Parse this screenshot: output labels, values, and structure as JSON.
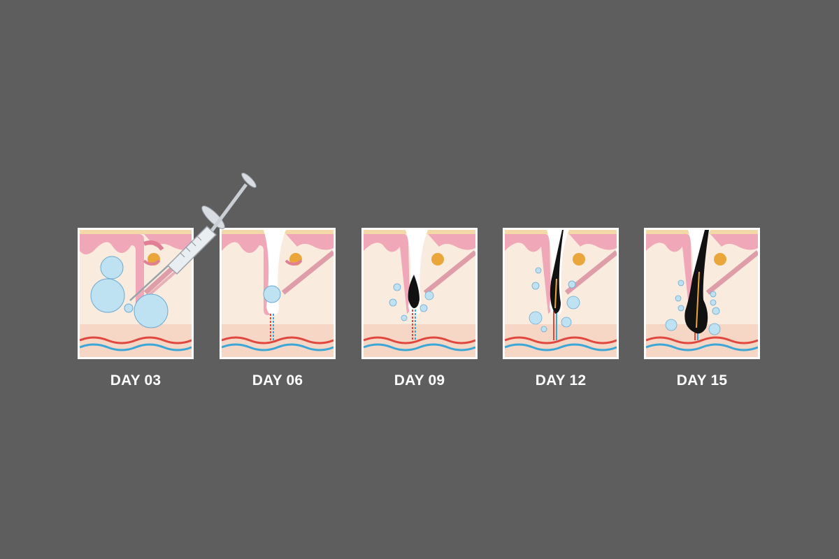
{
  "colors": {
    "background": "#5e5e5e",
    "skin_surface": "#f0a7b7",
    "dermis": "#f9ecdf",
    "fat_layer": "#f6d7c5",
    "artery": "#e0473e",
    "vein": "#3ba7d8",
    "gland": "#eaa63a",
    "hair": "#111111",
    "bubble": "#bfe2f3"
  },
  "stages": [
    {
      "day": "DAY 03",
      "icon": "syringe-injection-icon"
    },
    {
      "day": "DAY 06",
      "icon": "follicle-bulb-icon"
    },
    {
      "day": "DAY 09",
      "icon": "new-hair-sprout-icon"
    },
    {
      "day": "DAY 12",
      "icon": "hair-growth-icon"
    },
    {
      "day": "DAY 15",
      "icon": "full-hair-icon"
    }
  ]
}
